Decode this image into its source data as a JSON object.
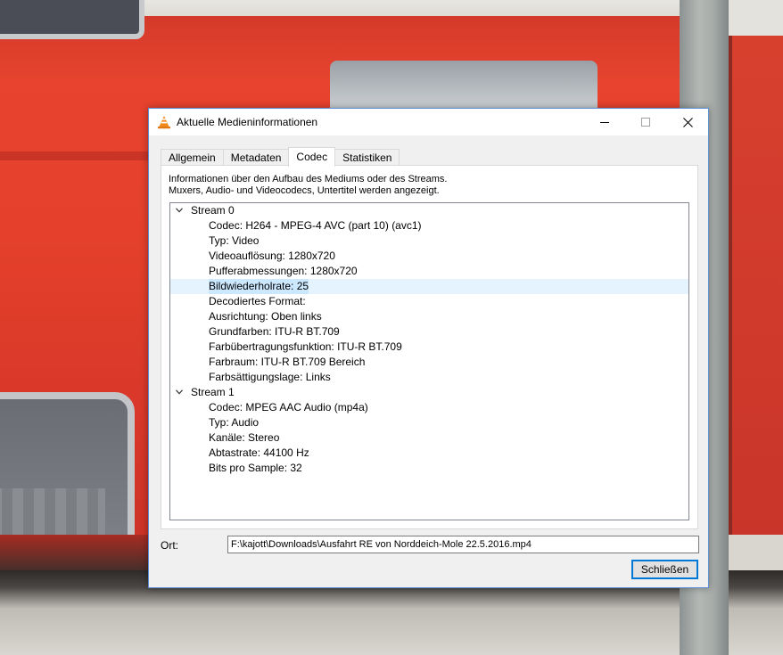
{
  "window": {
    "title": "Aktuelle Medieninformationen",
    "icon": "vlc-cone-icon"
  },
  "tabs": [
    {
      "label": "Allgemein",
      "active": false
    },
    {
      "label": "Metadaten",
      "active": false
    },
    {
      "label": "Codec",
      "active": true
    },
    {
      "label": "Statistiken",
      "active": false
    }
  ],
  "codec_tab": {
    "description_line1": "Informationen über den Aufbau des Mediums oder des Streams.",
    "description_line2": "Muxers, Audio- und Videocodecs, Untertitel werden angezeigt.",
    "tree": [
      {
        "kind": "stream",
        "text": "Stream 0",
        "expanded": true
      },
      {
        "kind": "prop",
        "text": "Codec: H264 - MPEG-4 AVC (part 10) (avc1)"
      },
      {
        "kind": "prop",
        "text": "Typ: Video"
      },
      {
        "kind": "prop",
        "text": "Videoauflösung: 1280x720"
      },
      {
        "kind": "prop",
        "text": "Pufferabmessungen: 1280x720"
      },
      {
        "kind": "prop",
        "text": "Bildwiederholrate: 25",
        "selected": true
      },
      {
        "kind": "prop",
        "text": "Decodiertes Format:"
      },
      {
        "kind": "prop",
        "text": "Ausrichtung: Oben links"
      },
      {
        "kind": "prop",
        "text": "Grundfarben: ITU-R BT.709"
      },
      {
        "kind": "prop",
        "text": "Farbübertragungsfunktion: ITU-R BT.709"
      },
      {
        "kind": "prop",
        "text": "Farbraum: ITU-R BT.709 Bereich"
      },
      {
        "kind": "prop",
        "text": "Farbsättigungslage: Links"
      },
      {
        "kind": "stream",
        "text": "Stream 1",
        "expanded": true
      },
      {
        "kind": "prop",
        "text": "Codec: MPEG AAC Audio (mp4a)"
      },
      {
        "kind": "prop",
        "text": "Typ: Audio"
      },
      {
        "kind": "prop",
        "text": "Kanäle: Stereo"
      },
      {
        "kind": "prop",
        "text": "Abtastrate: 44100 Hz"
      },
      {
        "kind": "prop",
        "text": "Bits pro Sample: 32"
      }
    ]
  },
  "location": {
    "label": "Ort:",
    "value": "F:\\kajott\\Downloads\\Ausfahrt RE von Norddeich-Mole 22.5.2016.mp4"
  },
  "buttons": {
    "close_label": "Schließen"
  },
  "colors": {
    "selection": "#cce8ff",
    "focus_border": "#0078d7",
    "window_border": "#5a8fd6"
  }
}
